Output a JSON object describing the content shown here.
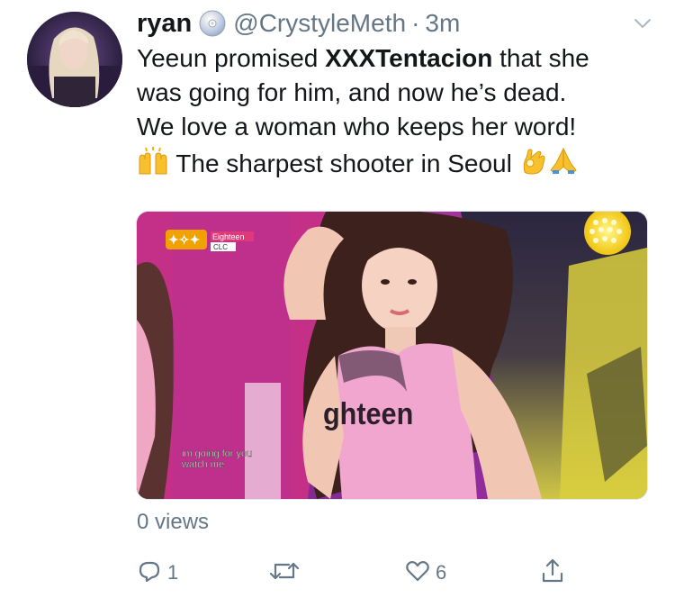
{
  "tweet": {
    "author_name": "ryan",
    "author_handle": "@CrystyleMeth",
    "separator": "·",
    "timestamp": "3m",
    "text_line1_pre": "Yeeun promised ",
    "text_line1_bold": "XXXTentacion",
    "text_line1_post": " that she",
    "text_line2": "was going for him, and now he’s dead.",
    "text_line3": "We love a woman who keeps her word!",
    "text_line4": " The sharpest shooter in Seoul ",
    "views": "0 views"
  },
  "media": {
    "badge_show": "Eighteen",
    "badge_group": "CLC",
    "shirt_text": "ghteen",
    "subtitle_line1": "im going for you",
    "subtitle_line2": "watch me"
  },
  "actions": {
    "reply_count": "1",
    "retweet_count": "",
    "like_count": "6"
  },
  "icons": {
    "reply": "reply-icon",
    "retweet": "retweet-icon",
    "like": "heart-icon",
    "share": "share-icon",
    "more": "chevron-down-icon",
    "cd": "cd-icon"
  },
  "colors": {
    "text": "#14171a",
    "secondary": "#657786",
    "border": "#e1e8ed"
  }
}
